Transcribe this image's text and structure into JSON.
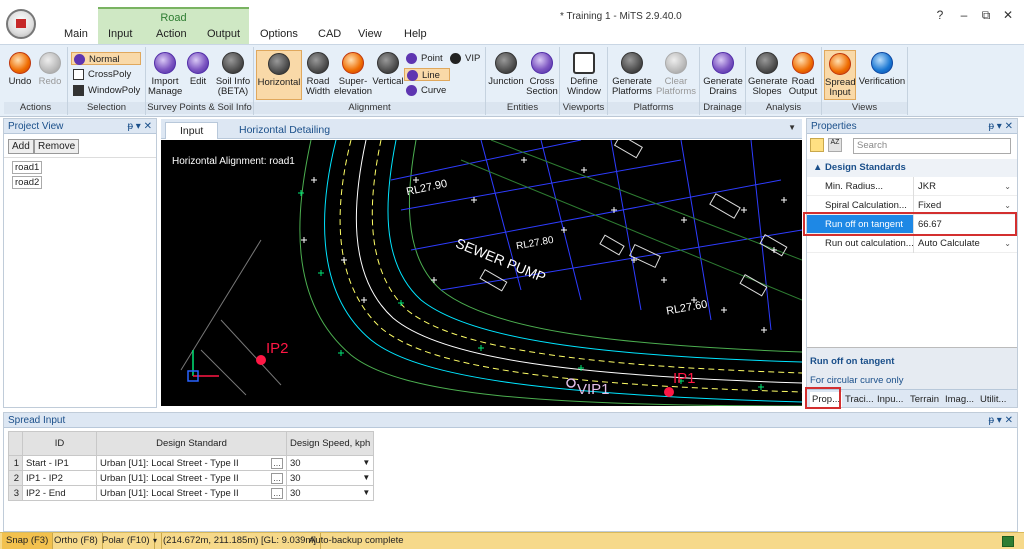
{
  "window": {
    "title": "* Training 1 - MiTS 2.9.40.0",
    "help": "?",
    "minimize": "–",
    "restore": "⧉",
    "close": "✕"
  },
  "ribbon_tabs": {
    "main": "Main",
    "input": "Input",
    "action": "Action",
    "output": "Output",
    "options": "Options",
    "cad": "CAD",
    "view": "View",
    "help": "Help",
    "context_group": "Road"
  },
  "ribbon": {
    "actions": {
      "label": "Actions",
      "undo": "Undo",
      "redo": "Redo"
    },
    "selection": {
      "label": "Selection",
      "normal": "Normal",
      "crosspoly": "CrossPoly",
      "windowpoly": "WindowPoly"
    },
    "survey": {
      "label": "Survey Points & Soil Info",
      "import": "Import",
      "manage": "Manage",
      "edit": "Edit",
      "soil1": "Soil Info",
      "soil2": "(BETA)"
    },
    "alignment": {
      "label": "Alignment",
      "horizontal": "Horizontal",
      "road1": "Road",
      "road2": "Width",
      "super1": "Super-",
      "super2": "elevation",
      "vertical": "Vertical",
      "point": "Point",
      "vip": "VIP",
      "line": "Line",
      "curve": "Curve"
    },
    "entities": {
      "label": "Entities",
      "junction": "Junction",
      "cross1": "Cross",
      "cross2": "Section"
    },
    "viewports": {
      "label": "Viewports",
      "define1": "Define",
      "define2": "Window"
    },
    "platforms": {
      "label": "Platforms",
      "gen1": "Generate",
      "gen2": "Platforms",
      "clear1": "Clear",
      "clear2": "Platforms"
    },
    "drainage": {
      "label": "Drainage",
      "gen1": "Generate",
      "gen2": "Drains"
    },
    "analysis": {
      "label": "Analysis",
      "slopes1": "Generate",
      "slopes2": "Slopes",
      "output1": "Road",
      "output2": "Output"
    },
    "views": {
      "label": "Views",
      "spread1": "Spread",
      "spread2": "Input",
      "verification": "Verification"
    }
  },
  "project_view": {
    "title": "Project View",
    "pin": "ᵽ ▾ ✕",
    "add": "Add",
    "remove": "Remove",
    "roads": [
      "road1",
      "road2"
    ]
  },
  "cad_tabs": {
    "input": "Input",
    "detailing": "Horizontal Detailing"
  },
  "cad": {
    "caption": "Horizontal Alignment: road1",
    "labels": {
      "rl1": "RL27.90",
      "rl2": "RL27.80",
      "rl3": "RL27.60",
      "sewer": "SEWER PUMP",
      "ip1": "IP1",
      "ip2": "IP2",
      "vip1": "VIP1"
    }
  },
  "properties": {
    "title": "Properties",
    "pin": "ᵽ ▾ ✕",
    "search_placeholder": "Search",
    "category": "Design Standards",
    "rows": [
      {
        "key": "Min. Radius...",
        "value": "JKR"
      },
      {
        "key": "Spiral Calculation...",
        "value": "Fixed"
      },
      {
        "key": "Run off on tangent",
        "value": "66.67"
      },
      {
        "key": "Run out calculation...",
        "value": "Auto Calculate"
      }
    ],
    "desc_title": "Run off on tangent",
    "desc_text": "For circular curve only",
    "bottom_tabs": [
      "Prop...",
      "Traci...",
      "Inpu...",
      "Terrain",
      "Imag...",
      "Utilit..."
    ]
  },
  "spread_input": {
    "title": "Spread Input",
    "pin": "ᵽ ▾ ✕",
    "columns": [
      "ID",
      "Design Standard",
      "Design Speed, kph"
    ],
    "rows": [
      {
        "n": "1",
        "id": "Start - IP1",
        "std": "Urban [U1]: Local Street - Type II",
        "speed": "30"
      },
      {
        "n": "2",
        "id": "IP1 - IP2",
        "std": "Urban [U1]: Local Street - Type II",
        "speed": "30"
      },
      {
        "n": "3",
        "id": "IP2 - End",
        "std": "Urban [U1]: Local Street - Type II",
        "speed": "30"
      }
    ]
  },
  "status": {
    "snap": "Snap (F3)",
    "ortho": "Ortho (F8)",
    "polar": "Polar (F10)",
    "coords": "(214.672m, 211.185m) [GL: 9.039m]",
    "message": "Auto-backup complete"
  }
}
